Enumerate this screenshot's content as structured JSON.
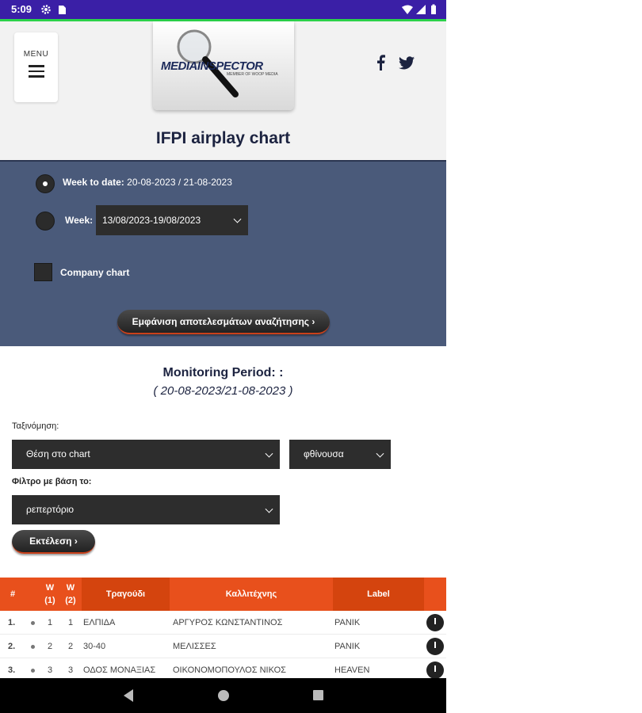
{
  "status_bar": {
    "time": "5:09"
  },
  "header": {
    "menu_label": "MENU",
    "logo_text": "MEDIAINSPECTOR",
    "logo_subtext": "MEMBER OF WOOP MEDIA",
    "page_title": "IFPI airplay chart"
  },
  "filters": {
    "week_to_date_label": "Week to date:",
    "week_to_date_value": "20-08-2023 / 21-08-2023",
    "week_label": "Week:",
    "week_select_value": "13/08/2023-19/08/2023",
    "company_chart_label": "Company chart",
    "show_results_button": "Εμφάνιση αποτελεσμάτων αναζήτησης ›"
  },
  "monitoring": {
    "title": "Monitoring Period: :",
    "dates": "( 20-08-2023/21-08-2023 )"
  },
  "sorting": {
    "sort_label": "Ταξινόμηση:",
    "sort_by_value": "Θέση στο chart",
    "order_value": "φθίνουσα",
    "filter_label": "Φίλτρο με βάση το:",
    "filter_value": "ρεπερτόριο",
    "execute_button": "Εκτέλεση ›"
  },
  "table": {
    "headers": {
      "rank": "#",
      "w1": "W (1)",
      "w2": "W (2)",
      "song": "Τραγούδι",
      "artist": "Καλλιτέχνης",
      "label": "Label"
    },
    "rows": [
      {
        "rank": "1.",
        "w1": "1",
        "w2": "1",
        "song": "ΕΛΠΙΔΑ",
        "artist": "ΑΡΓΥΡΟΣ ΚΩΝΣΤΑΝΤΙΝΟΣ",
        "label": "PANIK"
      },
      {
        "rank": "2.",
        "w1": "2",
        "w2": "2",
        "song": "30-40",
        "artist": "ΜΕΛΙΣΣΕΣ",
        "label": "PANIK"
      },
      {
        "rank": "3.",
        "w1": "3",
        "w2": "3",
        "song": "ΟΔΟΣ ΜΟΝΑΞΙΑΣ",
        "artist": "ΟΙΚΟΝΟΜΟΠΟΥΛΟΣ ΝΙΚΟΣ",
        "label": "HEAVEN"
      }
    ]
  },
  "colors": {
    "status_bar": "#3a1fa6",
    "panel": "#4a5a7a",
    "table_header": "#e8501c",
    "accent_line": "#2bd24a"
  }
}
